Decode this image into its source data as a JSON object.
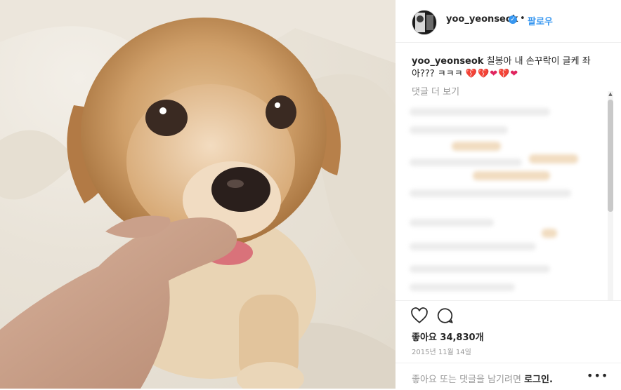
{
  "post": {
    "username": "yoo_yeonseok",
    "follow_label": "팔로우",
    "separator": "•",
    "caption_user": "yoo_yeonseok",
    "caption_text": "칠봉아 내 손꾸락이 글케 좌아??? ㅋㅋㅋ",
    "caption_hearts": "💔💔❤💔❤",
    "view_more": "댓글 더 보기",
    "likes": "좋아요 34,830개",
    "date": "2015년 11월 14일",
    "login_prompt": "좋아요 또는 댓글을 남기려면",
    "login_link": "로그인.",
    "more_menu": "•••"
  },
  "icons": {
    "verified": "verified-badge-icon",
    "like": "heart-outline-icon",
    "comment": "comment-bubble-icon",
    "more": "ellipsis-icon"
  },
  "colors": {
    "link_blue": "#3897f0",
    "text": "#262626",
    "muted": "#999999",
    "heart_red": "#e0245e"
  }
}
